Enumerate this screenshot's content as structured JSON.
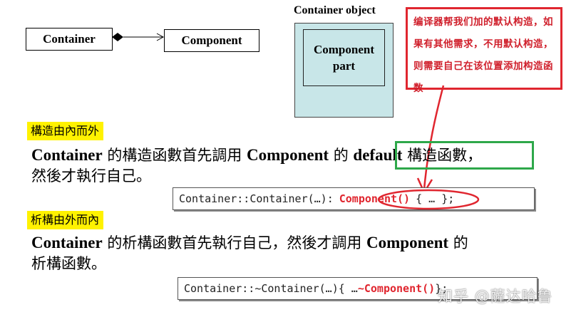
{
  "uml": {
    "container_label": "Container",
    "component_label": "Component"
  },
  "object": {
    "title": "Container object",
    "inner_line1": "Component",
    "inner_line2": "part"
  },
  "note": {
    "text": "编译器帮我们加的默认构造，如果有其他需求，不用默认构造，则需要自己在该位置添加构造函数",
    "color": "#e0262f"
  },
  "ctor_section": {
    "tag": "構造由內而外",
    "line1_a": "Container",
    "line1_b": " 的構造函數首先調用 ",
    "line1_c": "Component",
    "line1_d": " 的 ",
    "line1_e": "default",
    "line1_f": " 構造函數，",
    "line2": "然後才執行自己。",
    "code_prefix": "Container::Container(…):",
    "code_highlight": "Component()",
    "code_suffix": "{ … };"
  },
  "dtor_section": {
    "tag": "析構由外而內",
    "line1_a": "Container",
    "line1_b": " 的析構函數首先執行自己，然後才調用 ",
    "line1_c": "Component",
    "line1_d": " 的",
    "line2": "析構函數。",
    "code_prefix": "Container::~Container(…){ … ",
    "code_highlight": "~Component()",
    "code_suffix": " };"
  },
  "watermark": "知乎 @薩达哈鲁",
  "colors": {
    "highlight_yellow": "#fff200",
    "green_box": "#2ea84a",
    "object_fill": "#c8e6e8",
    "red": "#e0262f"
  }
}
